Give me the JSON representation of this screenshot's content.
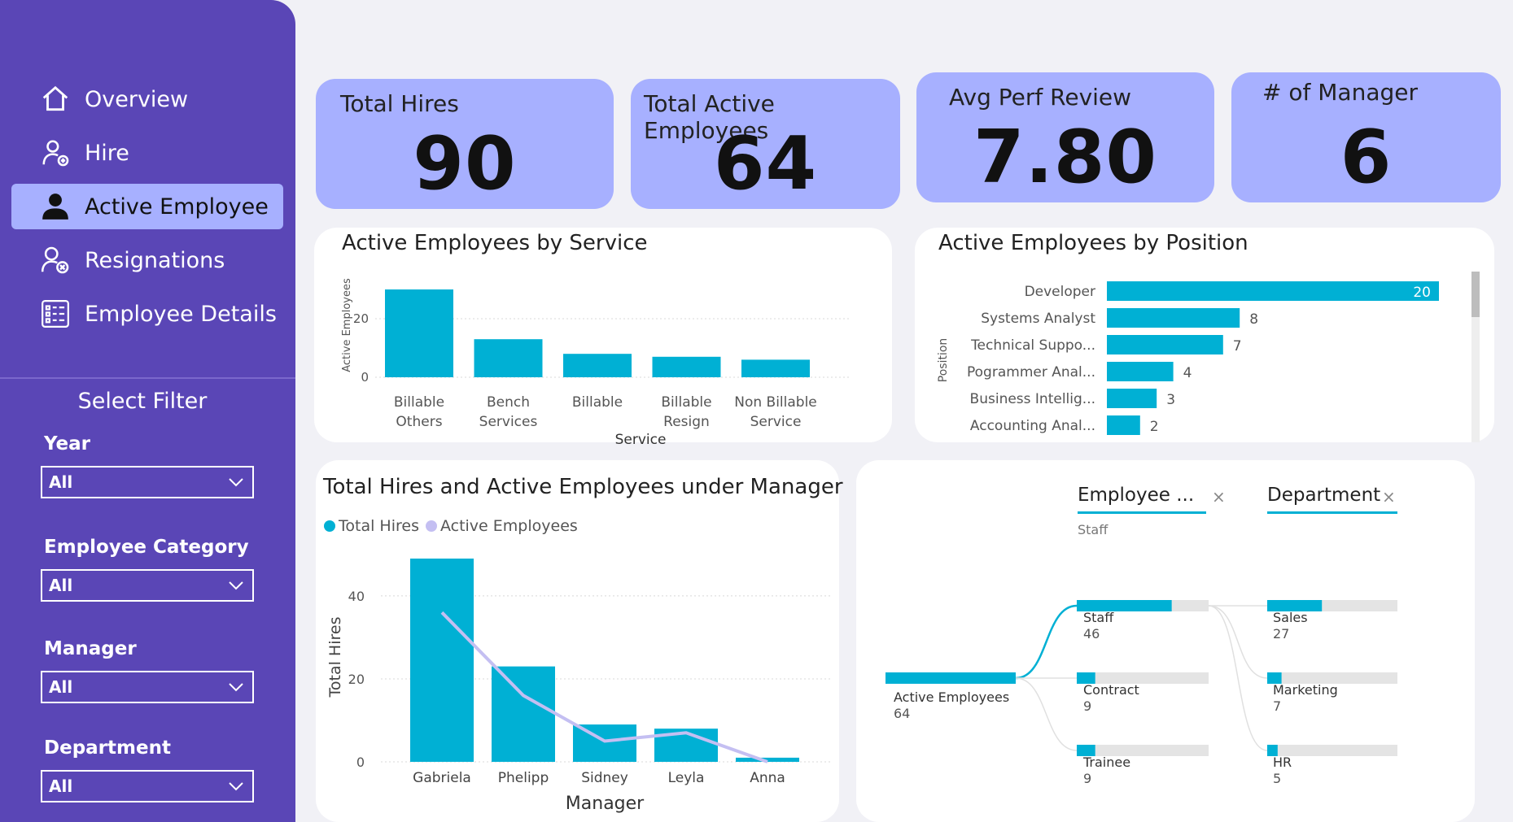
{
  "nav": {
    "items": [
      {
        "label": "Overview",
        "icon": "home-icon"
      },
      {
        "label": "Hire",
        "icon": "add-user-icon"
      },
      {
        "label": "Active Employee",
        "icon": "user-icon"
      },
      {
        "label": "Resignations",
        "icon": "remove-user-icon"
      },
      {
        "label": "Employee Details",
        "icon": "details-grid-icon"
      }
    ],
    "active_index": 2
  },
  "filters": {
    "title": "Select Filter",
    "items": [
      {
        "label": "Year",
        "value": "All"
      },
      {
        "label": "Employee Category",
        "value": "All"
      },
      {
        "label": "Manager",
        "value": "All"
      },
      {
        "label": "Department",
        "value": "All"
      }
    ]
  },
  "kpis": [
    {
      "title": "Total Hires",
      "value": "90"
    },
    {
      "title": "Total Active Employees",
      "value": "64"
    },
    {
      "title": "Avg Perf Review",
      "value": "7.80"
    },
    {
      "title": "# of Manager",
      "value": "6"
    }
  ],
  "colors": {
    "sidebar": "#5a46b6",
    "card": "#a7b0ff",
    "bar": "#00b0d4",
    "line": "#c4bff2",
    "track": "#e4e4e4"
  },
  "service_chart": {
    "title": "Active Employees by Service"
  },
  "position_chart": {
    "title": "Active Employees by Position"
  },
  "manager_chart": {
    "title": "Total Hires and Active Employees under Manager",
    "legend_hires": "Total Hires",
    "legend_active": "Active Employees"
  },
  "decomp": {
    "header1": "Employee ...",
    "header1_sub": "Staff",
    "header2": "Department",
    "root": {
      "label": "Active Employees",
      "value": "64",
      "fraction": 1.0
    },
    "level1": [
      {
        "label": "Staff",
        "value": "46",
        "fraction": 0.72
      },
      {
        "label": "Contract",
        "value": "9",
        "fraction": 0.14
      },
      {
        "label": "Trainee",
        "value": "9",
        "fraction": 0.14
      }
    ],
    "level2": [
      {
        "label": "Sales",
        "value": "27",
        "fraction": 0.42
      },
      {
        "label": "Marketing",
        "value": "7",
        "fraction": 0.11
      },
      {
        "label": "HR",
        "value": "5",
        "fraction": 0.08
      }
    ]
  },
  "chart_data": [
    {
      "type": "bar",
      "title": "Active Employees by Service",
      "categories": [
        [
          "Billable",
          "Others"
        ],
        [
          "Bench",
          "Services"
        ],
        [
          "Billable"
        ],
        [
          "Billable",
          "Resign"
        ],
        [
          "Non Billable",
          "Service"
        ]
      ],
      "values": [
        30,
        13,
        8,
        7,
        6
      ],
      "xlabel": "Service",
      "ylabel": "Active Employees",
      "ylim": [
        0,
        30
      ],
      "yticks": [
        0,
        20
      ],
      "grid": true
    },
    {
      "type": "bar",
      "orientation": "horizontal",
      "title": "Active Employees by Position",
      "categories": [
        "Developer",
        "Systems Analyst",
        "Technical Suppo...",
        "Pogrammer Anal...",
        "Business Intellig...",
        "Accounting Anal..."
      ],
      "values": [
        20,
        8,
        7,
        4,
        3,
        2
      ],
      "ylabel": "Position",
      "xlim": [
        0,
        20
      ]
    },
    {
      "type": "bar",
      "title": "Total Hires and Active Employees under Manager",
      "categories": [
        "Gabriela",
        "Phelipp",
        "Sidney",
        "Leyla",
        "Anna"
      ],
      "series": [
        {
          "name": "Total Hires",
          "type": "bar",
          "values": [
            49,
            23,
            9,
            8,
            1
          ]
        },
        {
          "name": "Active Employees",
          "type": "line",
          "values": [
            36,
            16,
            5,
            7,
            0
          ]
        }
      ],
      "xlabel": "Manager",
      "ylabel": "Total Hires",
      "ylim": [
        0,
        49
      ],
      "yticks": [
        0,
        20,
        40
      ],
      "grid": true,
      "legend": "top-left"
    }
  ]
}
